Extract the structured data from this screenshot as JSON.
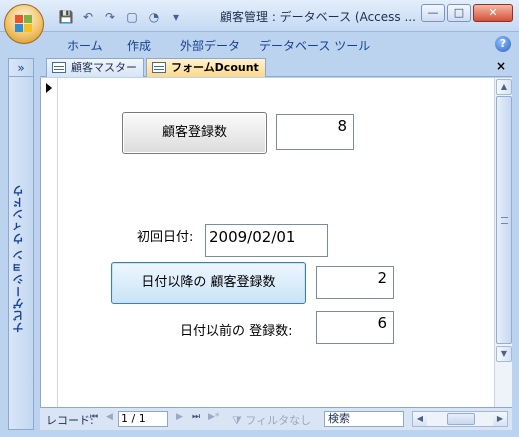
{
  "window": {
    "title": "顧客管理 : データベース (Access ...",
    "minimize_glyph": "—",
    "maximize_glyph": "□",
    "close_glyph": "✕"
  },
  "quick_access": {
    "save_icon": "💾",
    "undo_icon": "↶",
    "redo_icon": "↷",
    "new_icon": "▢",
    "open_icon": "◔",
    "customize_icon": "▾"
  },
  "ribbon": {
    "tabs": [
      "ホーム",
      "作成",
      "外部データ",
      "データベース ツール"
    ],
    "help_glyph": "?"
  },
  "nav_pane": {
    "toggle_glyph": "»",
    "label": "ナビゲーション ウィンドウ"
  },
  "doc_tabs": {
    "tabs": [
      {
        "label": "顧客マスター",
        "active": false
      },
      {
        "label": "フォームDcount",
        "active": true
      }
    ],
    "close_glyph": "×"
  },
  "form": {
    "customer_count_button": "顧客登録数",
    "customer_count_value": "8",
    "first_date_label": "初回日付:",
    "first_date_value": "2009/02/01",
    "after_date_button": "日付以降の 顧客登録数",
    "after_date_value": "2",
    "before_date_label": "日付以前の 登録数:",
    "before_date_value": "6"
  },
  "status_bar": {
    "record_label": "レコード:",
    "first_glyph": "⏮",
    "prev_glyph": "◀",
    "record_value": "1 / 1",
    "next_glyph": "▶",
    "last_glyph": "⏭",
    "new_glyph": "▶*",
    "filter_label": "フィルタなし",
    "search_label": "検索"
  },
  "colors": {
    "chrome": "#bcd3ef",
    "active_tab": "#fcd88b",
    "form_bg": "#ffffff"
  }
}
